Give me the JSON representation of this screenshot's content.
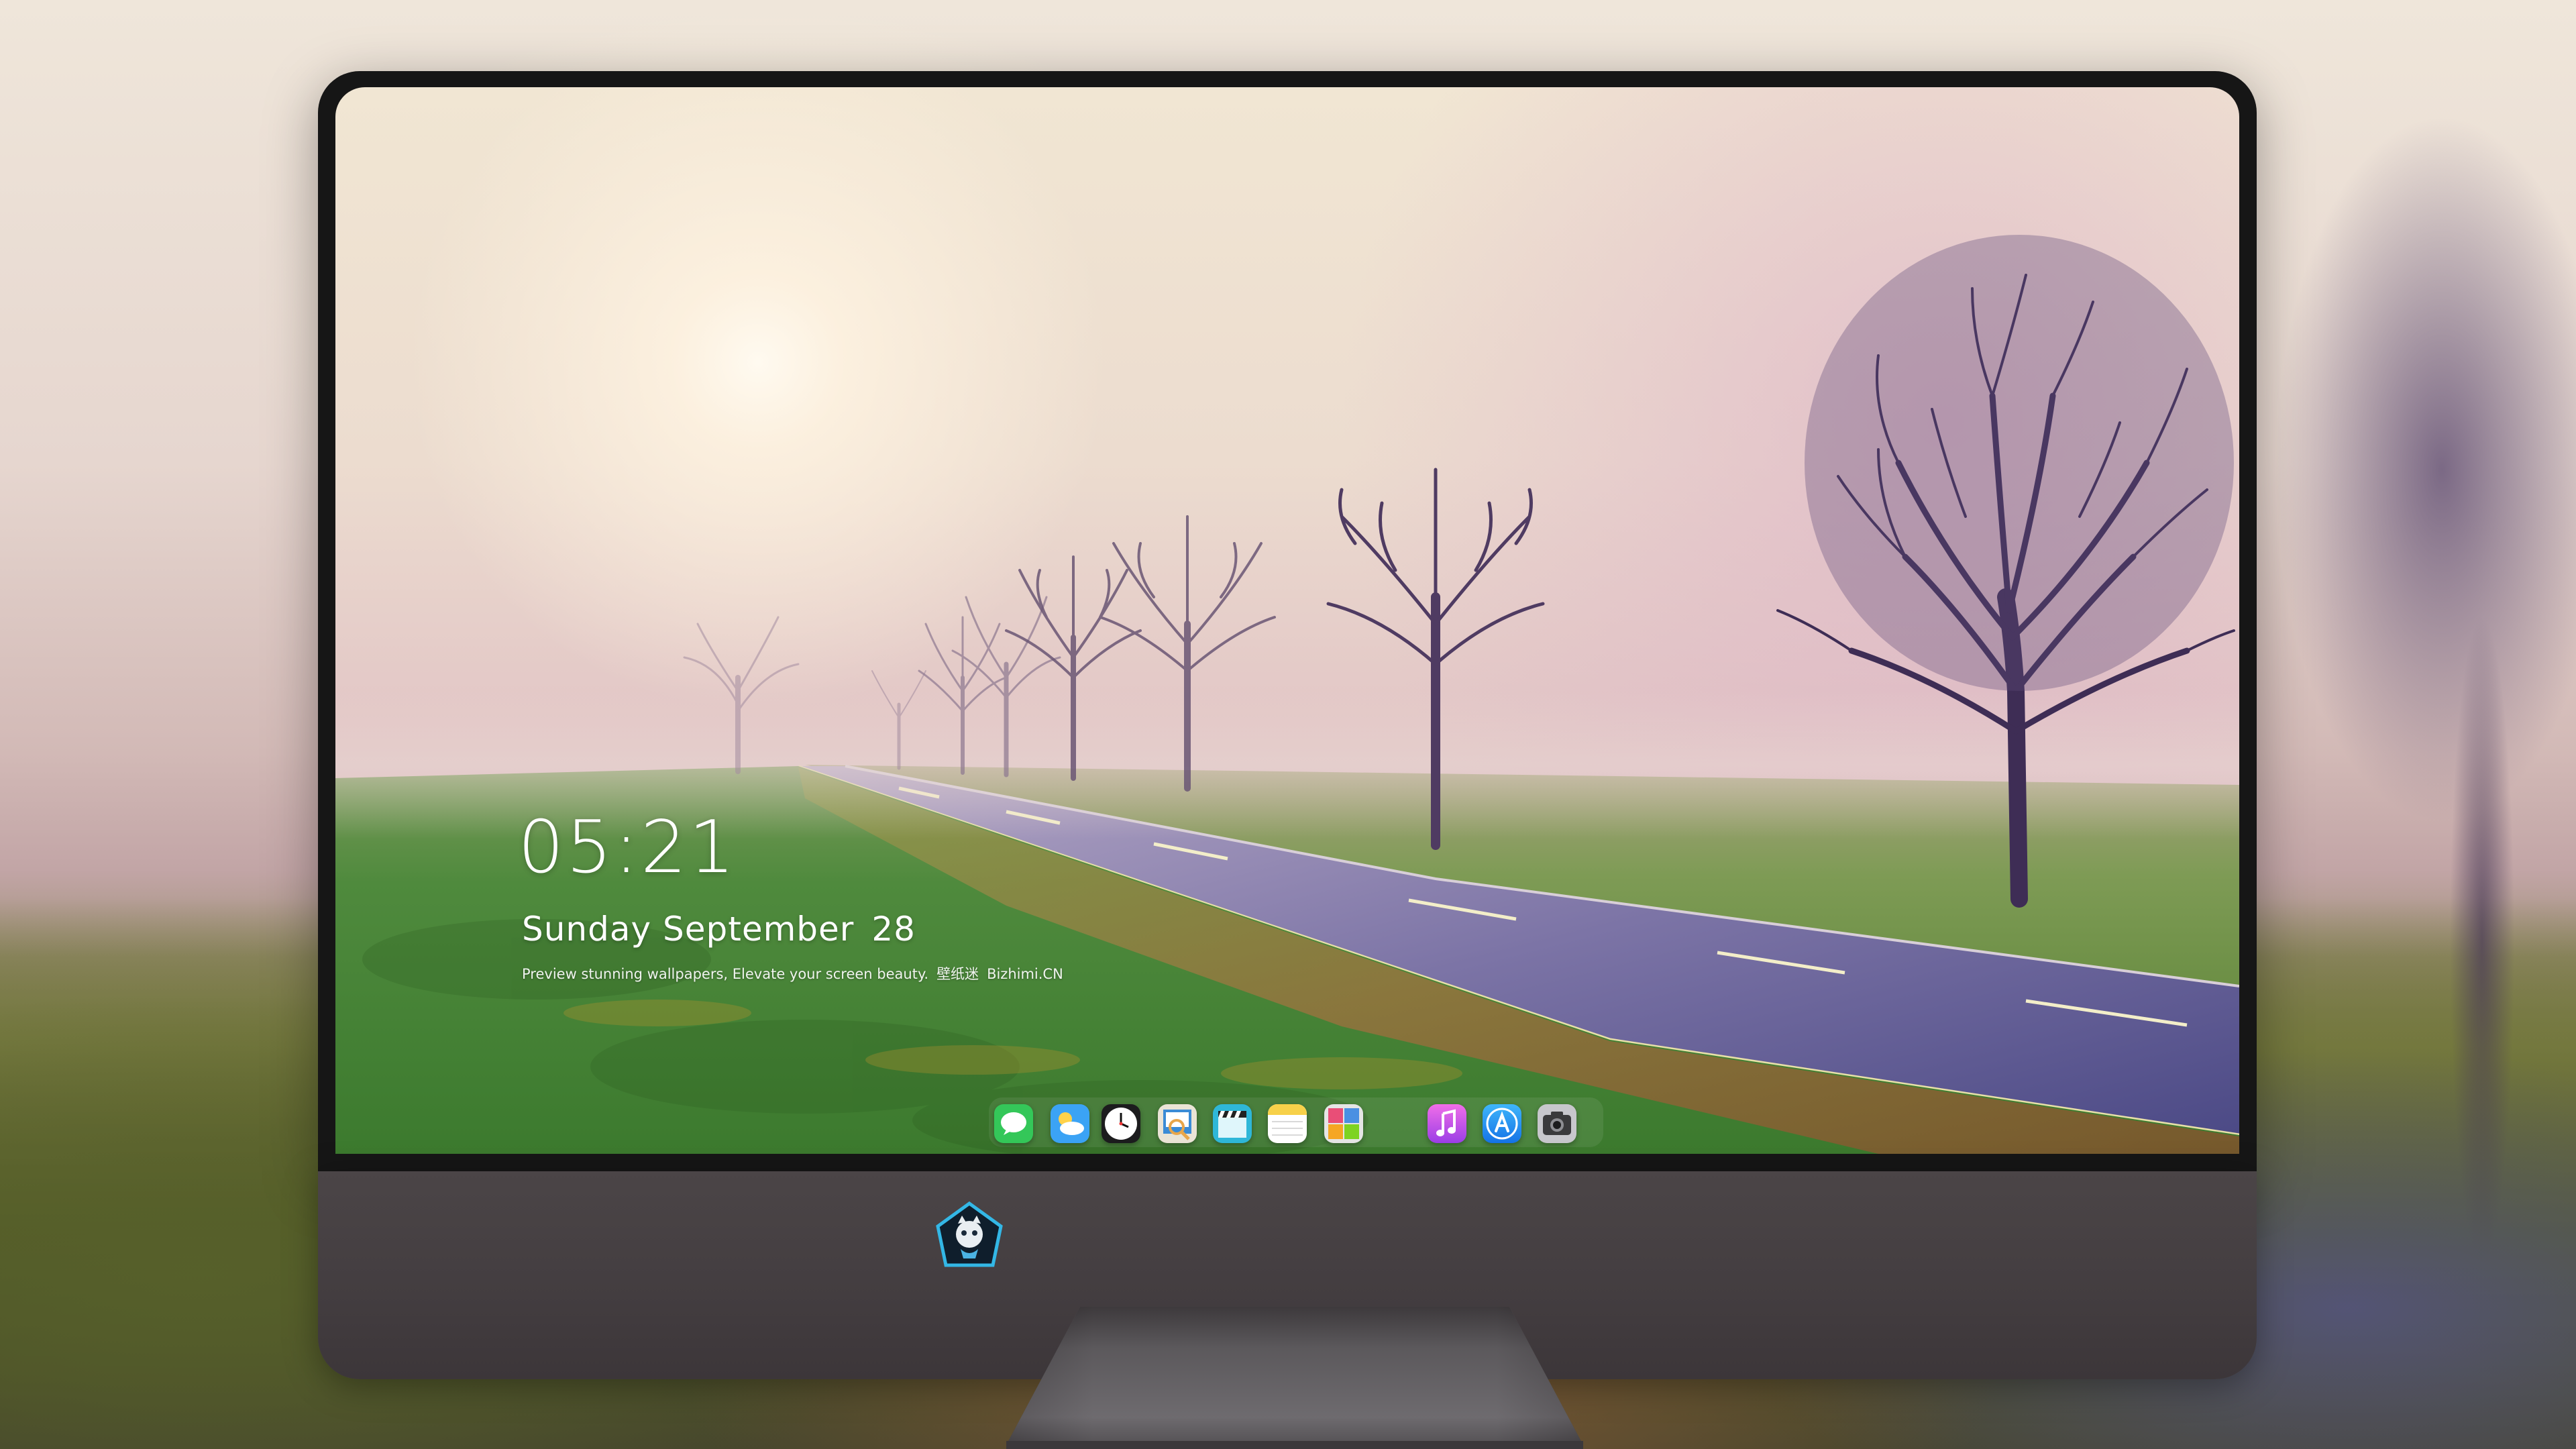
{
  "lock_screen": {
    "time": "05:21",
    "date_weekday_month": "Sunday September",
    "date_day": "28",
    "tagline": "Preview stunning wallpapers, Elevate your screen beauty.",
    "brand_cn": "壁纸迷",
    "brand_en": "Bizhimi.CN"
  },
  "dock": {
    "apps": [
      {
        "name": "messages-icon",
        "color": "#34c759"
      },
      {
        "name": "weather-icon",
        "color": "#3ba3f5"
      },
      {
        "name": "clock-icon",
        "color": "#1c1c1e"
      },
      {
        "name": "preview-icon",
        "color": "#e9a64a"
      },
      {
        "name": "video-clapper-icon",
        "color": "#2fb7d8"
      },
      {
        "name": "notes-icon",
        "color": "#f7d14a"
      },
      {
        "name": "photo-collage-icon",
        "color": "#e5e5e5"
      },
      {
        "name": "music-icon",
        "color": "#d54be8"
      },
      {
        "name": "app-store-icon",
        "color": "#1e8cf0"
      },
      {
        "name": "camera-icon",
        "color": "#8e8e93"
      }
    ]
  },
  "colors": {
    "monitor_bezel": "#161616",
    "monitor_chin": "#433d40",
    "stand": "#5a5a5e"
  }
}
